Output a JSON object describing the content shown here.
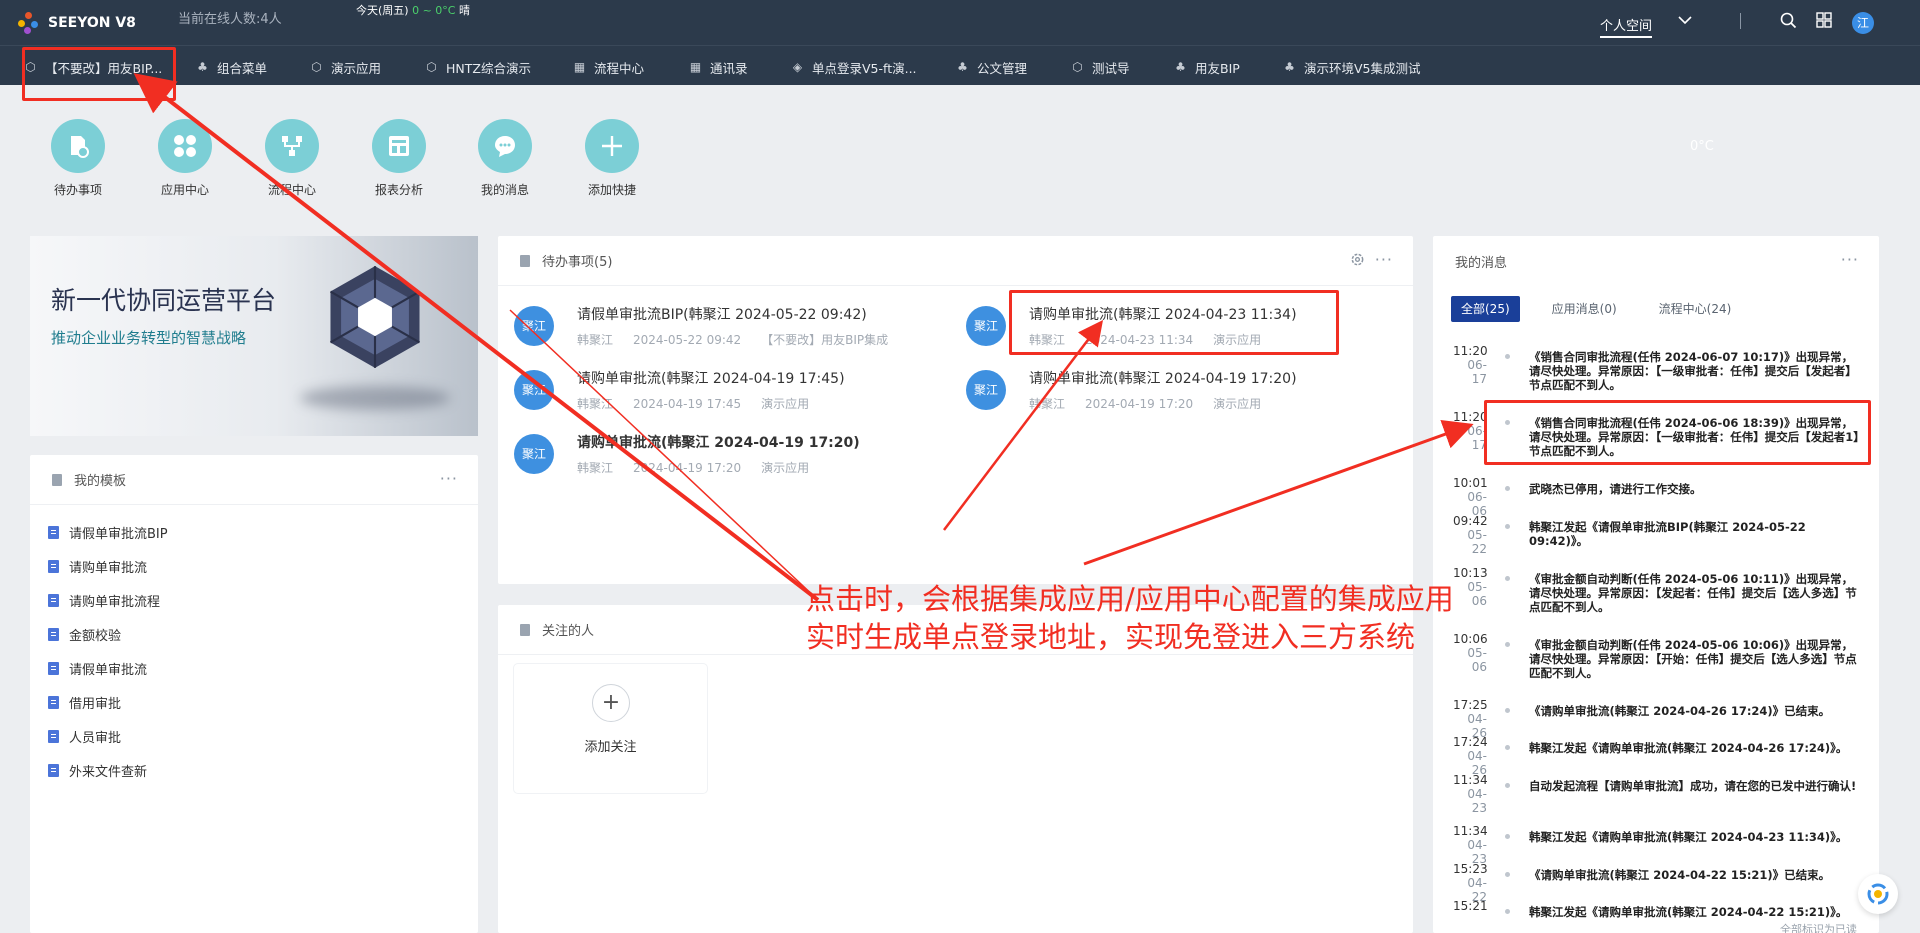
{
  "topbar": {
    "brand": "SEEYON V8",
    "online": "当前在线人数:4人",
    "weather_day": "今天(周五)",
    "weather_temp": "0 ~ 0°C",
    "weather_cond": "晴",
    "space": "个人空间",
    "avatar": "江"
  },
  "nav": [
    {
      "label": "【不要改】用友BIP..."
    },
    {
      "label": "组合菜单"
    },
    {
      "label": "演示应用"
    },
    {
      "label": "HNTZ综合演示"
    },
    {
      "label": "流程中心"
    },
    {
      "label": "通讯录"
    },
    {
      "label": "单点登录V5-ft演..."
    },
    {
      "label": "公文管理"
    },
    {
      "label": "测试导"
    },
    {
      "label": "用友BIP"
    },
    {
      "label": "演示环境V5集成测试"
    }
  ],
  "quick": [
    {
      "label": "待办事项",
      "icon": "document-clock-icon"
    },
    {
      "label": "应用中心",
      "icon": "apps-grid-icon"
    },
    {
      "label": "流程中心",
      "icon": "flow-icon"
    },
    {
      "label": "报表分析",
      "icon": "report-icon"
    },
    {
      "label": "我的消息",
      "icon": "chat-bubble-icon"
    },
    {
      "label": "添加快捷",
      "icon": "plus-icon"
    }
  ],
  "temperature": "0°C",
  "banner": {
    "title": "新一代协同运营平台",
    "subtitle": "推动企业业务转型的智慧战略"
  },
  "templates": {
    "title": "我的模板",
    "items": [
      "请假单审批流BIP",
      "请购单审批流",
      "请购单审批流程",
      "金额校验",
      "请假单审批流",
      "借用审批",
      "人员审批",
      "外来文件查新"
    ]
  },
  "todo": {
    "title": "待办事项(5)",
    "items": [
      {
        "avatar": "聚江",
        "title": "请假单审批流BIP(韩聚江 2024-05-22 09:42)",
        "user": "韩聚江",
        "date": "2024-05-22 09:42",
        "app": "【不要改】用友BIP集成"
      },
      {
        "avatar": "聚江",
        "title": "请购单审批流(韩聚江 2024-04-23 11:34)",
        "user": "韩聚江",
        "date": "2024-04-23 11:34",
        "app": "演示应用"
      },
      {
        "avatar": "聚江",
        "title": "请购单审批流(韩聚江 2024-04-19 17:45)",
        "user": "韩聚江",
        "date": "2024-04-19 17:45",
        "app": "演示应用"
      },
      {
        "avatar": "聚江",
        "title": "请购单审批流(韩聚江 2024-04-19 17:20)",
        "user": "韩聚江",
        "date": "2024-04-19 17:20",
        "app": "演示应用"
      },
      {
        "avatar": "聚江",
        "title": "请购单审批流(韩聚江 2024-04-19 17:20)",
        "user": "韩聚江",
        "date": "2024-04-19 17:20",
        "app": "演示应用"
      }
    ]
  },
  "follow": {
    "title": "关注的人",
    "add": "添加关注"
  },
  "messages": {
    "title": "我的消息",
    "tabs": [
      "全部(25)",
      "应用消息(0)",
      "流程中心(24)"
    ],
    "items": [
      {
        "time": "11:20",
        "date": "06-17",
        "text": "《销售合同审批流程(任伟 2024-06-07 10:17)》出现异常，请尽快处理。异常原因：【一级审批者：任伟】提交后【发起者】节点匹配不到人。"
      },
      {
        "time": "11:20",
        "date": "06-17",
        "text": "《销售合同审批流程(任伟 2024-06-06 18:39)》出现异常，请尽快处理。异常原因：【一级审批者：任伟】提交后【发起者1】节点匹配不到人。"
      },
      {
        "time": "10:01",
        "date": "06-06",
        "text": "武晓杰已停用，请进行工作交接。"
      },
      {
        "time": "09:42",
        "date": "05-22",
        "text": "韩聚江发起《请假单审批流BIP(韩聚江 2024-05-22 09:42)》。"
      },
      {
        "time": "10:13",
        "date": "05-06",
        "text": "《审批金额自动判断(任伟 2024-05-06 10:11)》出现异常，请尽快处理。异常原因：【发起者：任伟】提交后【选人多选】节点匹配不到人。"
      },
      {
        "time": "10:06",
        "date": "05-06",
        "text": "《审批金额自动判断(任伟 2024-05-06 10:06)》出现异常，请尽快处理。异常原因：【开始：任伟】提交后【选人多选】节点匹配不到人。"
      },
      {
        "time": "17:25",
        "date": "04-26",
        "text": "《请购单审批流(韩聚江 2024-04-26 17:24)》已结束。"
      },
      {
        "time": "17:24",
        "date": "04-26",
        "text": "韩聚江发起《请购单审批流(韩聚江 2024-04-26 17:24)》。"
      },
      {
        "time": "11:34",
        "date": "04-23",
        "text": "自动发起流程【请购单审批流】成功，请在您的已发中进行确认!"
      },
      {
        "time": "11:34",
        "date": "04-23",
        "text": "韩聚江发起《请购单审批流(韩聚江 2024-04-23 11:34)》。"
      },
      {
        "time": "15:23",
        "date": "04-22",
        "text": "《请购单审批流(韩聚江 2024-04-22 15:21)》已结束。"
      },
      {
        "time": "15:21",
        "date": "",
        "text": "韩聚江发起《请购单审批流(韩聚江 2024-04-22 15:21)》。"
      }
    ],
    "footer": "全部标识为已读"
  },
  "annotation": {
    "line1": "点击时，会根据集成应用/应用中心配置的集成应用",
    "line2": "实时生成单点登录地址，实现免登进入三方系统"
  },
  "colors": {
    "topbar": "#2c3a4b",
    "accent": "#1a3f99",
    "quick_circle": "#7ccfd6",
    "avatar": "#3e90e0",
    "annotation_red": "#f12e22"
  }
}
